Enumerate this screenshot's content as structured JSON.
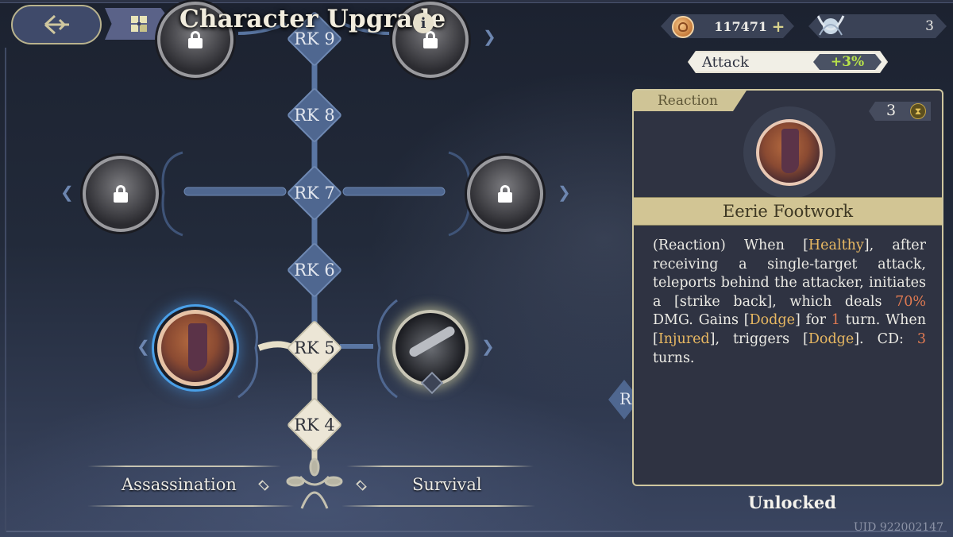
{
  "header": {
    "title": "Character Upgrade",
    "back_icon": "back-arrow-icon",
    "menu_icon": "grid-menu-icon",
    "info_label": "i"
  },
  "currencies": {
    "gold": {
      "icon": "coin-icon",
      "value": "117471",
      "add_label": "+"
    },
    "gem": {
      "icon": "crystal-orb-icon",
      "value": "3"
    }
  },
  "bonus": {
    "label": "Attack",
    "value": "+3%"
  },
  "tree": {
    "ranks": [
      {
        "label": "RK 9",
        "state": "locked"
      },
      {
        "label": "RK 8",
        "state": "locked"
      },
      {
        "label": "RK 7",
        "state": "locked"
      },
      {
        "label": "RK 6",
        "state": "locked"
      },
      {
        "label": "RK 5",
        "state": "unlocked"
      },
      {
        "label": "RK 4",
        "state": "unlocked"
      }
    ],
    "skills": [
      {
        "rank": "RK 9",
        "side": "left",
        "state": "locked"
      },
      {
        "rank": "RK 9",
        "side": "right",
        "state": "locked"
      },
      {
        "rank": "RK 7",
        "side": "left",
        "state": "locked"
      },
      {
        "rank": "RK 7",
        "side": "right",
        "state": "locked"
      },
      {
        "rank": "RK 5",
        "side": "left",
        "state": "selected",
        "name": "Eerie Footwork"
      },
      {
        "rank": "RK 5",
        "side": "right",
        "state": "available"
      }
    ],
    "branches": {
      "left": "Assassination",
      "right": "Survival"
    },
    "partial_rank_label": "R"
  },
  "detail": {
    "type_tag": "Reaction",
    "cost": "3",
    "cost_icon": "hourglass-icon",
    "skill_name": "Eerie Footwork",
    "description": {
      "p1": "(Reaction) When [",
      "k1": "Healthy",
      "p2": "], after receiving a single-target attack, teleports behind the attacker, initiates a [strike back], which deals ",
      "n1": "70%",
      "p3": " DMG. Gains [",
      "k2": "Dodge",
      "p4": "] for ",
      "n2": "1",
      "p5": " turn. When [",
      "k3": "Injured",
      "p6": "], triggers [",
      "k4": "Dodge",
      "p7": "]. CD: ",
      "n3": "3",
      "p8": " turns."
    },
    "status": "Unlocked"
  },
  "uid": "UID 922002147",
  "colors": {
    "accent_gold": "#cfc496",
    "keyword": "#e8b862",
    "number": "#e07a52",
    "bonus_green": "#b8e34a",
    "rank_locked": "#4f6790",
    "rank_unlocked": "#ece6d6"
  }
}
